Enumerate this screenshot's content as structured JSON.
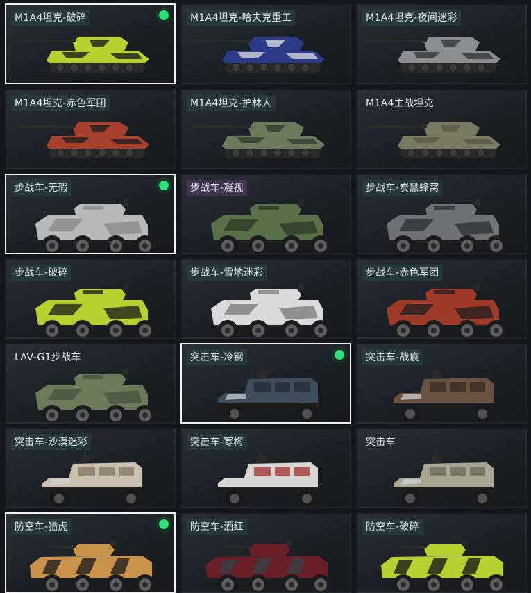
{
  "cards": [
    {
      "label": "M1A4坦克-破碎",
      "type": "tank",
      "c1": "#b8d030",
      "c2": "#232820",
      "selected": true,
      "equipped": true,
      "tag": "teal"
    },
    {
      "label": "M1A4坦克-哈夫克重工",
      "type": "tank",
      "c1": "#2c3a88",
      "c2": "#c8ccd4",
      "selected": false,
      "equipped": false,
      "tag": "teal"
    },
    {
      "label": "M1A4坦克-夜间迷彩",
      "type": "tank",
      "c1": "#8a8e92",
      "c2": "#3a3e42",
      "selected": false,
      "equipped": false,
      "tag": "teal"
    },
    {
      "label": "M1A4坦克-赤色军团",
      "type": "tank",
      "c1": "#a8402e",
      "c2": "#2a2220",
      "selected": false,
      "equipped": false,
      "tag": "teal"
    },
    {
      "label": "M1A4坦克-护林人",
      "type": "tank",
      "c1": "#6e7a5c",
      "c2": "#3a4232",
      "selected": false,
      "equipped": false,
      "tag": "teal"
    },
    {
      "label": "M1A4主战坦克",
      "type": "tank",
      "c1": "#7a7a62",
      "c2": "#5a5a48",
      "selected": false,
      "equipped": false,
      "tag": "plain"
    },
    {
      "label": "步战车-无瑕",
      "type": "ifv",
      "c1": "#b8b8b8",
      "c2": "#8c8c8c",
      "selected": true,
      "equipped": true,
      "tag": "teal"
    },
    {
      "label": "步战车-凝视",
      "type": "ifv",
      "c1": "#5a7048",
      "c2": "#2e3a28",
      "selected": false,
      "equipped": false,
      "tag": "purple"
    },
    {
      "label": "步战车-炭黑蜂窝",
      "type": "ifv",
      "c1": "#6e7276",
      "c2": "#2e3236",
      "selected": false,
      "equipped": false,
      "tag": "teal"
    },
    {
      "label": "步战车-破碎",
      "type": "ifv",
      "c1": "#b8d030",
      "c2": "#22281e",
      "selected": false,
      "equipped": false,
      "tag": "teal"
    },
    {
      "label": "步战车-雪地迷彩",
      "type": "ifv",
      "c1": "#d8dadc",
      "c2": "#7a7e82",
      "selected": false,
      "equipped": false,
      "tag": "teal"
    },
    {
      "label": "步战车-赤色军团",
      "type": "ifv",
      "c1": "#a03a28",
      "c2": "#282220",
      "selected": false,
      "equipped": false,
      "tag": "teal"
    },
    {
      "label": "LAV-G1步战车",
      "type": "ifv",
      "c1": "#6c7a5a",
      "c2": "#4a5640",
      "selected": false,
      "equipped": false,
      "tag": "plain"
    },
    {
      "label": "突击车-冷钢",
      "type": "assault",
      "c1": "#3e4c5c",
      "c2": "#262e38",
      "selected": true,
      "equipped": true,
      "tag": "teal"
    },
    {
      "label": "突击车-战痕",
      "type": "assault",
      "c1": "#6a5240",
      "c2": "#3a2e24",
      "selected": false,
      "equipped": false,
      "tag": "teal"
    },
    {
      "label": "突击车-沙漠迷彩",
      "type": "assault",
      "c1": "#c8bfae",
      "c2": "#8a7a68",
      "selected": false,
      "equipped": false,
      "tag": "teal"
    },
    {
      "label": "突击车-寒梅",
      "type": "assault",
      "c1": "#d8d6d2",
      "c2": "#a23a3a",
      "selected": false,
      "equipped": false,
      "tag": "teal"
    },
    {
      "label": "突击车",
      "type": "assault",
      "c1": "#a8a690",
      "c2": "#6e6c5a",
      "selected": false,
      "equipped": false,
      "tag": "plain"
    },
    {
      "label": "防空车-猎虎",
      "type": "aa",
      "c1": "#c8924a",
      "c2": "#2a2620",
      "selected": true,
      "equipped": true,
      "tag": "teal"
    },
    {
      "label": "防空车-酒红",
      "type": "aa",
      "c1": "#6a1e26",
      "c2": "#3a3e44",
      "selected": false,
      "equipped": false,
      "tag": "teal"
    },
    {
      "label": "防空车-破碎",
      "type": "aa",
      "c1": "#b8d030",
      "c2": "#22281e",
      "selected": false,
      "equipped": false,
      "tag": "teal"
    }
  ]
}
